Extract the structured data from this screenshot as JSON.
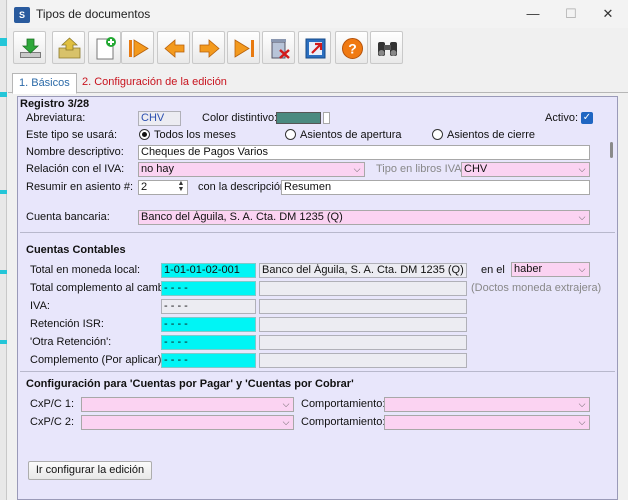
{
  "window": {
    "title": "Tipos de documentos",
    "minimize": "—",
    "maximize": "☐",
    "close": "✕"
  },
  "tabs": [
    {
      "label": "1. Básicos"
    },
    {
      "label": "2. Configuración de la edición"
    }
  ],
  "record": "Registro 3/28",
  "form": {
    "abreviatura_label": "Abreviatura:",
    "abreviatura_value": "CHV",
    "color_label": "Color distintivo:",
    "activo_label": "Activo:",
    "usara_label": "Este tipo se usará:",
    "radio_options": [
      "Todos los meses",
      "Asientos de apertura",
      "Asientos de cierre"
    ],
    "nombre_label": "Nombre descriptivo:",
    "nombre_value": "Cheques de Pagos Varios",
    "relacion_label": "Relación con el IVA:",
    "relacion_value": "no hay",
    "tipo_libros_label": "Tipo en libros IVA:",
    "tipo_libros_value": "CHV",
    "resumir_label": "Resumir en asiento #:",
    "resumir_value": "2",
    "con_desc_label": "con la descripción",
    "con_desc_value": "Resumen",
    "cuenta_bancaria_label": "Cuenta bancaria:",
    "cuenta_bancaria_value": "Banco del Águila, S. A. Cta. DM 1235 (Q)"
  },
  "cuentas": {
    "heading": "Cuentas Contables",
    "rows": [
      {
        "label": "Total en moneda local:",
        "code": "1-01-01-02-001",
        "desc": "Banco del Águila, S. A. Cta. DM 1235 (Q)"
      },
      {
        "label": "Total complemento al cambio:",
        "code": "- - - -",
        "desc": ""
      },
      {
        "label": "IVA:",
        "code": "- - - -",
        "desc": ""
      },
      {
        "label": "Retención ISR:",
        "code": "- - - -",
        "desc": ""
      },
      {
        "label": "'Otra Retención':",
        "code": "- - - -",
        "desc": ""
      },
      {
        "label": "Complemento (Por aplicar):",
        "code": "- - - -",
        "desc": ""
      }
    ],
    "en_el_label": "en el",
    "en_el_value": "haber",
    "doctos_note": "(Doctos moneda extrajera)"
  },
  "cxp": {
    "heading": "Configuración para 'Cuentas por Pagar' y 'Cuentas por Cobrar'",
    "rows": [
      {
        "label": "CxP/C 1:",
        "comp_label": "Comportamiento:"
      },
      {
        "label": "CxP/C 2:",
        "comp_label": "Comportamiento:"
      }
    ]
  },
  "button_ir": "Ir configurar la edición",
  "colors": {
    "panel": "#e8e6fb",
    "pink": "#fbd3f2",
    "cyan": "#00f5f5",
    "swatch": "#4a8a80",
    "tab_active": "#2b6aa8",
    "tab_inactive": "#c8141e"
  }
}
